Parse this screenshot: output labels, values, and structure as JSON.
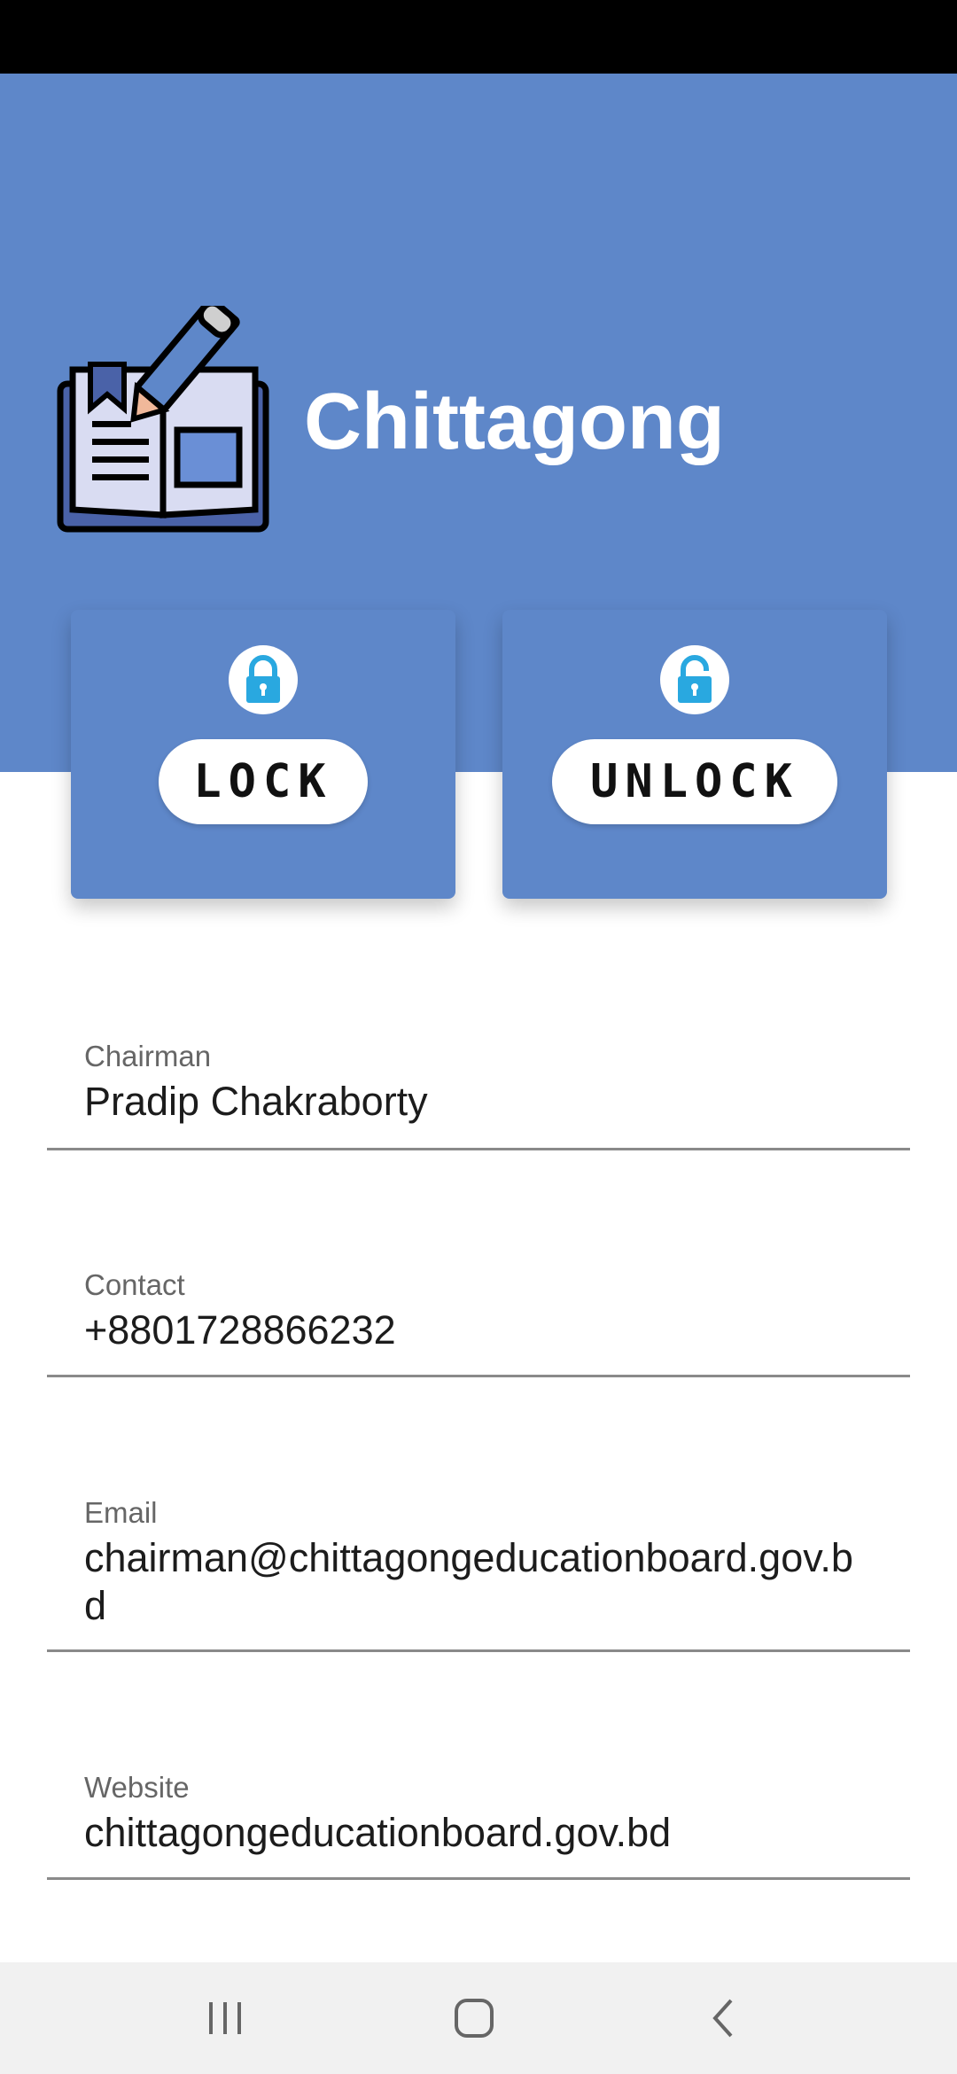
{
  "header": {
    "title": "Chittagong",
    "background_color": "#5e87c9",
    "logo_icon": "book-with-pencil-icon"
  },
  "actions": {
    "lock": {
      "label": "LOCK",
      "icon": "locked-padlock-icon"
    },
    "unlock": {
      "label": "UNLOCK",
      "icon": "unlocked-padlock-icon"
    },
    "icon_color": "#29a8e0"
  },
  "details": [
    {
      "label": "Chairman",
      "value": "Pradip Chakraborty"
    },
    {
      "label": "Contact",
      "value": "+8801728866232"
    },
    {
      "label": "Email",
      "value": "chairman@chittagongeducationboard.gov.bd"
    },
    {
      "label": "Website",
      "value": "chittagongeducationboard.gov.bd"
    }
  ],
  "navigation": {
    "recents": "recent-apps-icon",
    "home": "home-icon",
    "back": "back-icon"
  }
}
